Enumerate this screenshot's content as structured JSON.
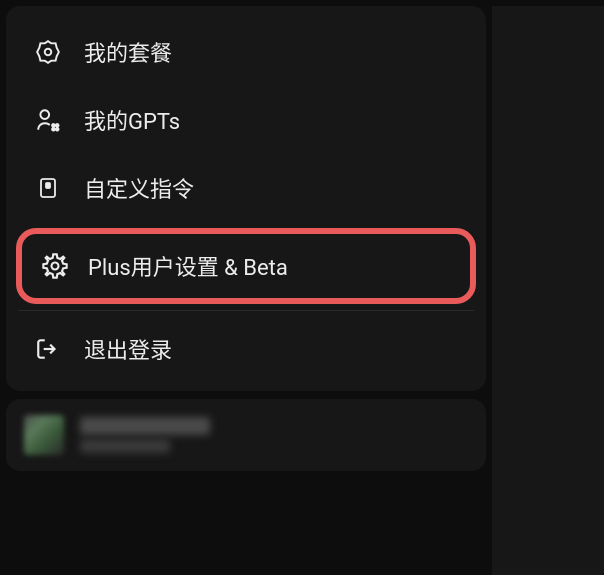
{
  "menu": {
    "items": [
      {
        "id": "my-plan",
        "label": "我的套餐",
        "icon": "badge-icon"
      },
      {
        "id": "my-gpts",
        "label": "我的GPTs",
        "icon": "user-robot-icon"
      },
      {
        "id": "custom-instructions",
        "label": "自定义指令",
        "icon": "card-icon"
      },
      {
        "id": "plus-settings-beta",
        "label": "Plus用户设置 & Beta",
        "icon": "settings-gear-icon",
        "highlighted": true
      },
      {
        "id": "logout",
        "label": "退出登录",
        "icon": "logout-icon"
      }
    ]
  },
  "colors": {
    "highlight_border": "#e95b5b",
    "panel_bg": "#171717",
    "text": "#ececec"
  }
}
